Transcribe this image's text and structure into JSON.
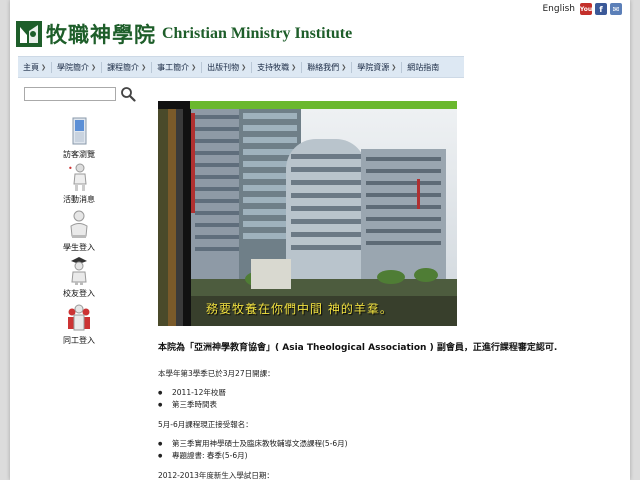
{
  "topbar": {
    "language_link": "English",
    "icons": [
      "youtube-icon",
      "facebook-icon",
      "email-icon"
    ],
    "youtube_label": "You",
    "facebook_label": "f",
    "mail_label": "✉"
  },
  "header": {
    "title_zh": "牧職神學院",
    "title_en": "Christian Ministry Institute",
    "brand_color": "#1e5e2a"
  },
  "nav": {
    "items": [
      {
        "label": "主頁"
      },
      {
        "label": "學院簡介"
      },
      {
        "label": "課程簡介"
      },
      {
        "label": "事工簡介"
      },
      {
        "label": "出版刊物"
      },
      {
        "label": "支持牧職"
      },
      {
        "label": "聯絡我們"
      },
      {
        "label": "學院資源"
      },
      {
        "label": "網站指南"
      }
    ],
    "chevron": "❯"
  },
  "search": {
    "value": "",
    "icon": "search-icon"
  },
  "sidebar": {
    "items": [
      {
        "label": "訪客瀏覽",
        "icon": "visitor-door-icon"
      },
      {
        "label": "活動消息",
        "icon": "news-person-icon"
      },
      {
        "label": "學生登入",
        "icon": "student-person-icon"
      },
      {
        "label": "校友登入",
        "icon": "alumni-person-icon"
      },
      {
        "label": "同工登入",
        "icon": "staff-group-icon"
      }
    ]
  },
  "banner": {
    "caption": "務要牧養在你們中間 神的羊羣。",
    "accent_green": "#6ab82e"
  },
  "content": {
    "lead": "本院為「亞洲神學教育協會」( Asia Theological Association ) 副會員，正進行課程審定認可.",
    "p1": "本學年第3學季已於3月27日開課：",
    "list1": [
      "2011-12年校曆",
      "第三季時間表"
    ],
    "p2": "5月-6月課程現正接受報名：",
    "list2": [
      "第三季實用神學碩士及臨床教牧輔導文憑課程(5-6月)",
      "專題證書: 春季(5-6月)"
    ],
    "p3": "2012-2013年度新生入學試日期："
  }
}
